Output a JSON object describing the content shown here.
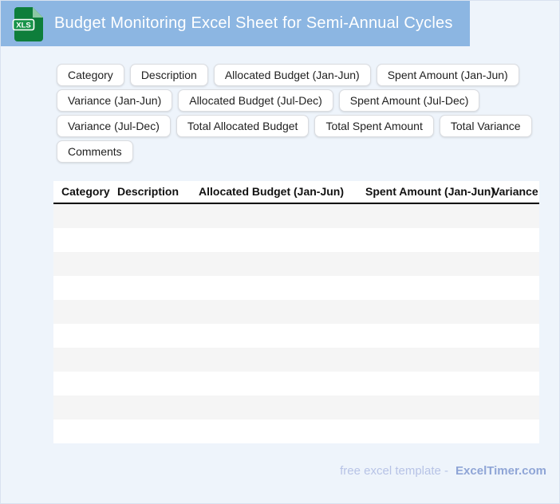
{
  "theme": {
    "page_bg": "#EEF4FB",
    "page_border": "#D9E2F0",
    "header_bg": "#8CB6E2",
    "header_title_color": "#FFFFFF",
    "chip_border": "#DADCE0",
    "chip_text": "#1F1F1F",
    "icon_green": "#0E7E3B",
    "icon_green_light": "#8CC7A4",
    "icon_band_green": "#18934A",
    "stripe": "#F5F5F5",
    "row_white": "#FFFFFF",
    "table_header_text": "#111111",
    "footer_text_color": "#B7C3E6",
    "footer_brand_color": "#8FA5D6"
  },
  "header": {
    "title": "Budget Monitoring Excel Sheet for Semi-Annual Cycles",
    "icon_label": "XLS"
  },
  "chips": {
    "items": [
      "Category",
      "Description",
      "Allocated Budget (Jan-Jun)",
      "Spent Amount (Jan-Jun)",
      "Variance (Jan-Jun)",
      "Allocated Budget (Jul-Dec)",
      "Spent Amount (Jul-Dec)",
      "Variance (Jul-Dec)",
      "Total Allocated Budget",
      "Total Spent Amount",
      "Total Variance",
      "Comments"
    ]
  },
  "table": {
    "columns": [
      "Category",
      "Description",
      "Allocated Budget (Jan-Jun)",
      "Spent Amount (Jan-Jun)",
      "Variance"
    ],
    "row_count": 10
  },
  "footer": {
    "note": "free excel template -",
    "brand": "ExcelTimer.com"
  }
}
